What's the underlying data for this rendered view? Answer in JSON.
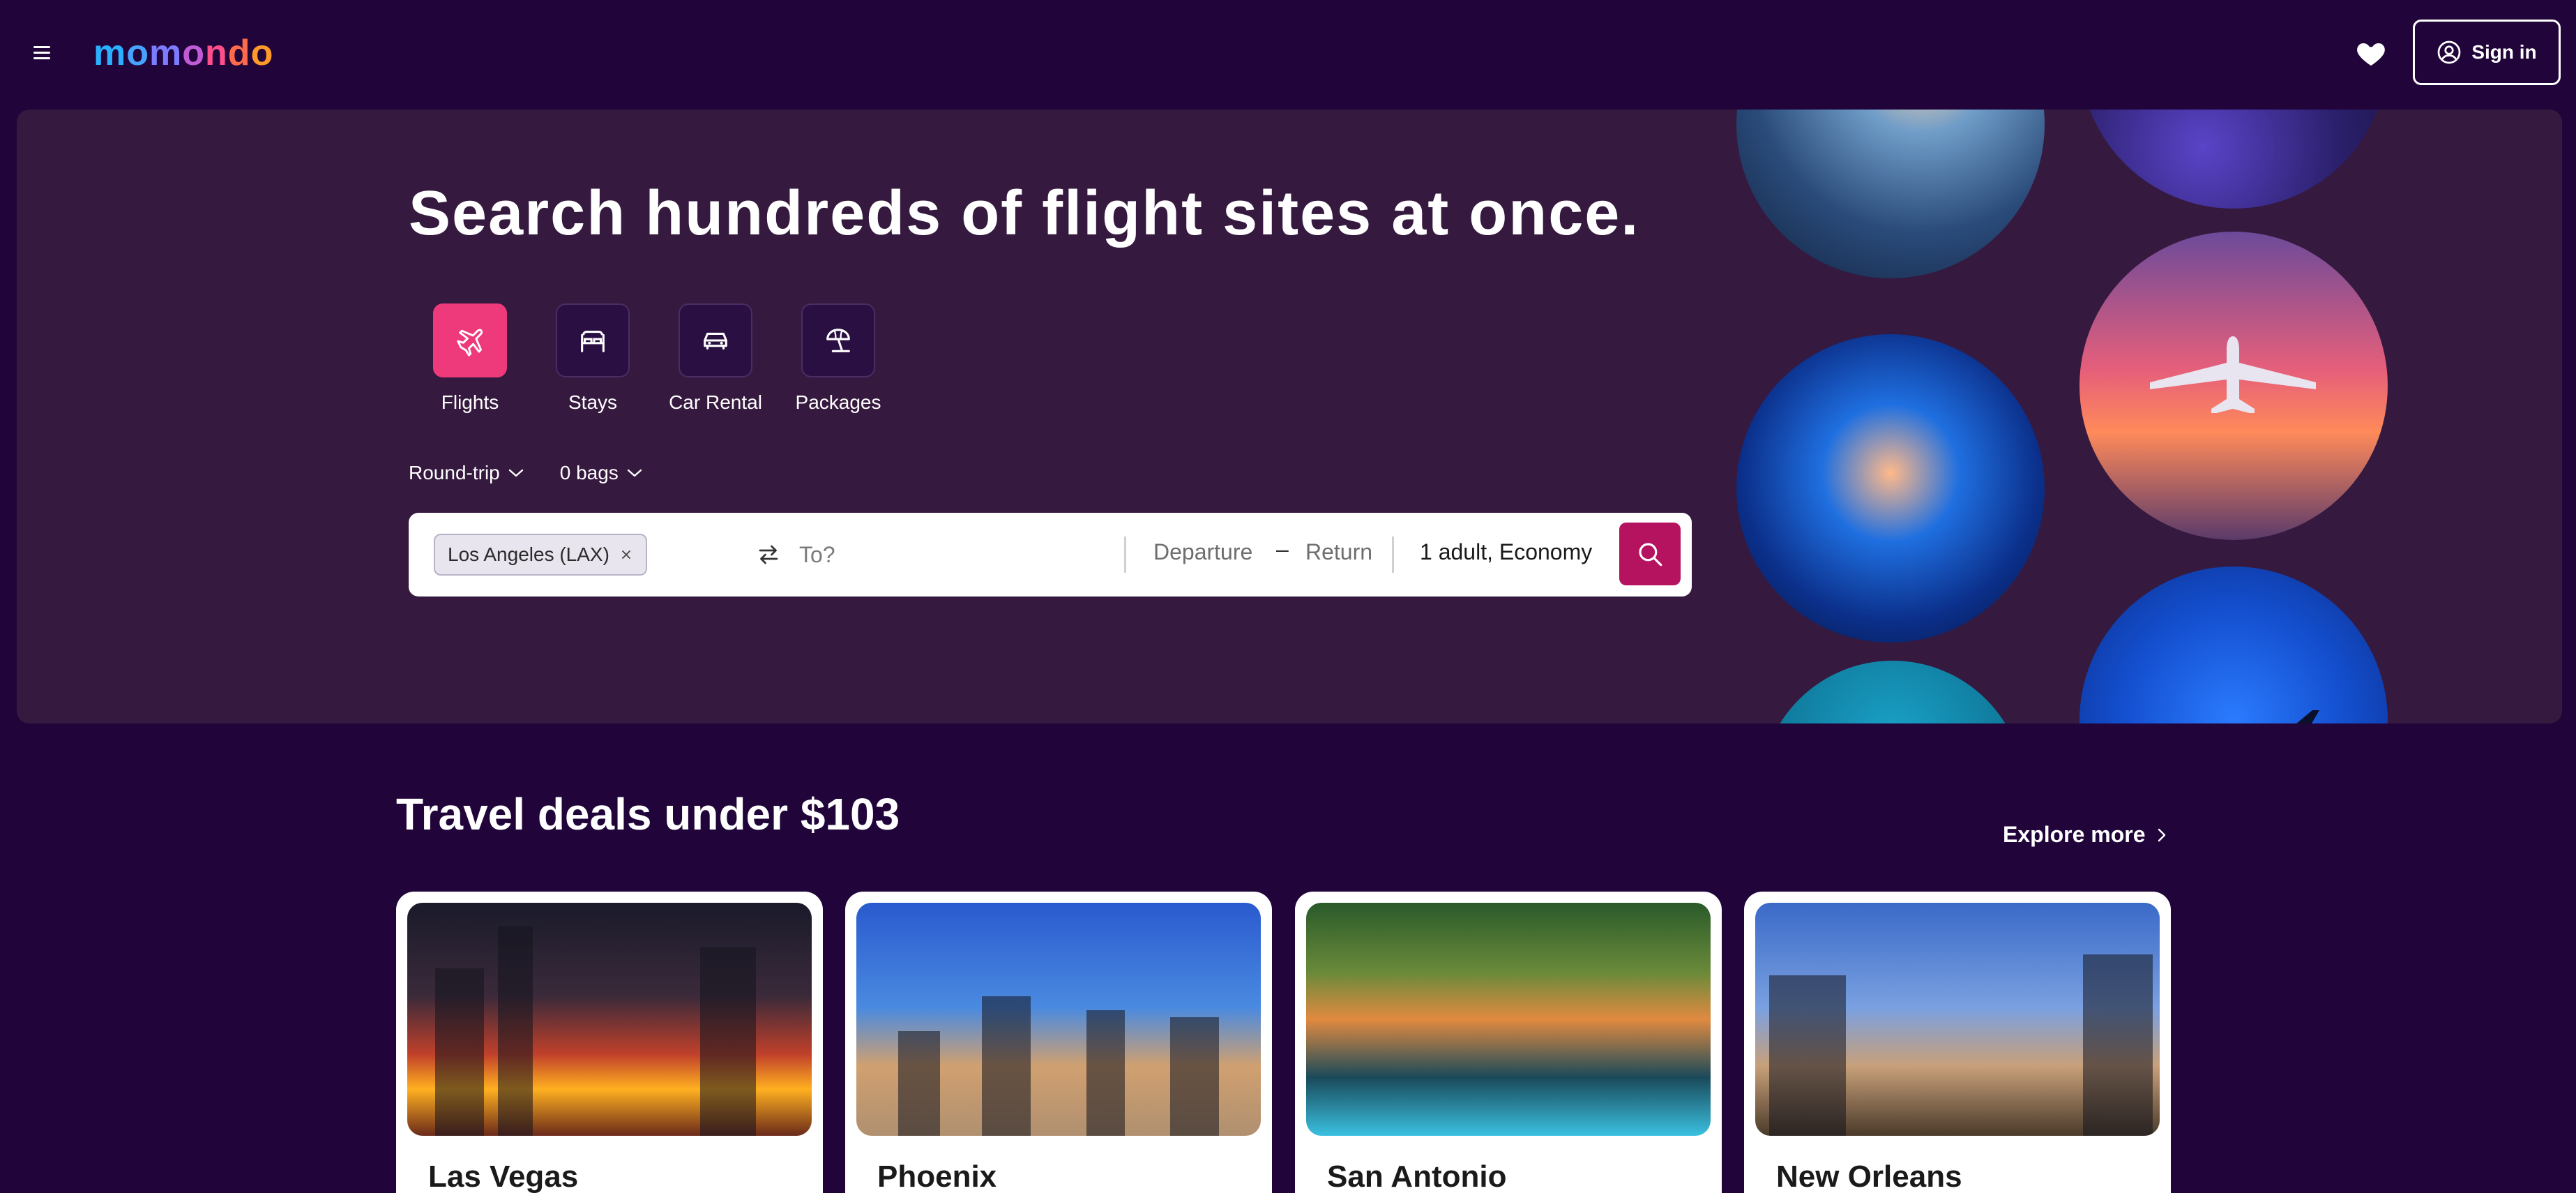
{
  "header": {
    "menu_icon": "hamburger-menu-icon",
    "logo_text": "momondo",
    "favorites_icon": "heart-icon",
    "signin_label": "Sign in",
    "signin_icon": "user-circle-icon"
  },
  "hero": {
    "title": "Search hundreds of flight sites at once.",
    "verticals": [
      {
        "label": "Flights",
        "icon": "plane-icon",
        "active": true
      },
      {
        "label": "Stays",
        "icon": "bed-icon",
        "active": false
      },
      {
        "label": "Car Rental",
        "icon": "car-icon",
        "active": false
      },
      {
        "label": "Packages",
        "icon": "beach-umbrella-icon",
        "active": false
      }
    ],
    "trip_type": "Round-trip",
    "bags": "0 bags",
    "search": {
      "origin_chip": "Los Angeles (LAX)",
      "destination_placeholder": "To?",
      "departure_placeholder": "Departure",
      "date_separator": "–",
      "return_placeholder": "Return",
      "travelers": "1 adult, Economy"
    }
  },
  "deals": {
    "title": "Travel deals under $103",
    "explore_label": "Explore more",
    "cards": [
      {
        "city": "Las Vegas"
      },
      {
        "city": "Phoenix"
      },
      {
        "city": "San Antonio"
      },
      {
        "city": "New Orleans"
      }
    ]
  },
  "colors": {
    "page_bg": "#21053a",
    "hero_bg": "#35193f",
    "accent_pink": "#ee3a7b",
    "search_button": "#b5125f"
  }
}
